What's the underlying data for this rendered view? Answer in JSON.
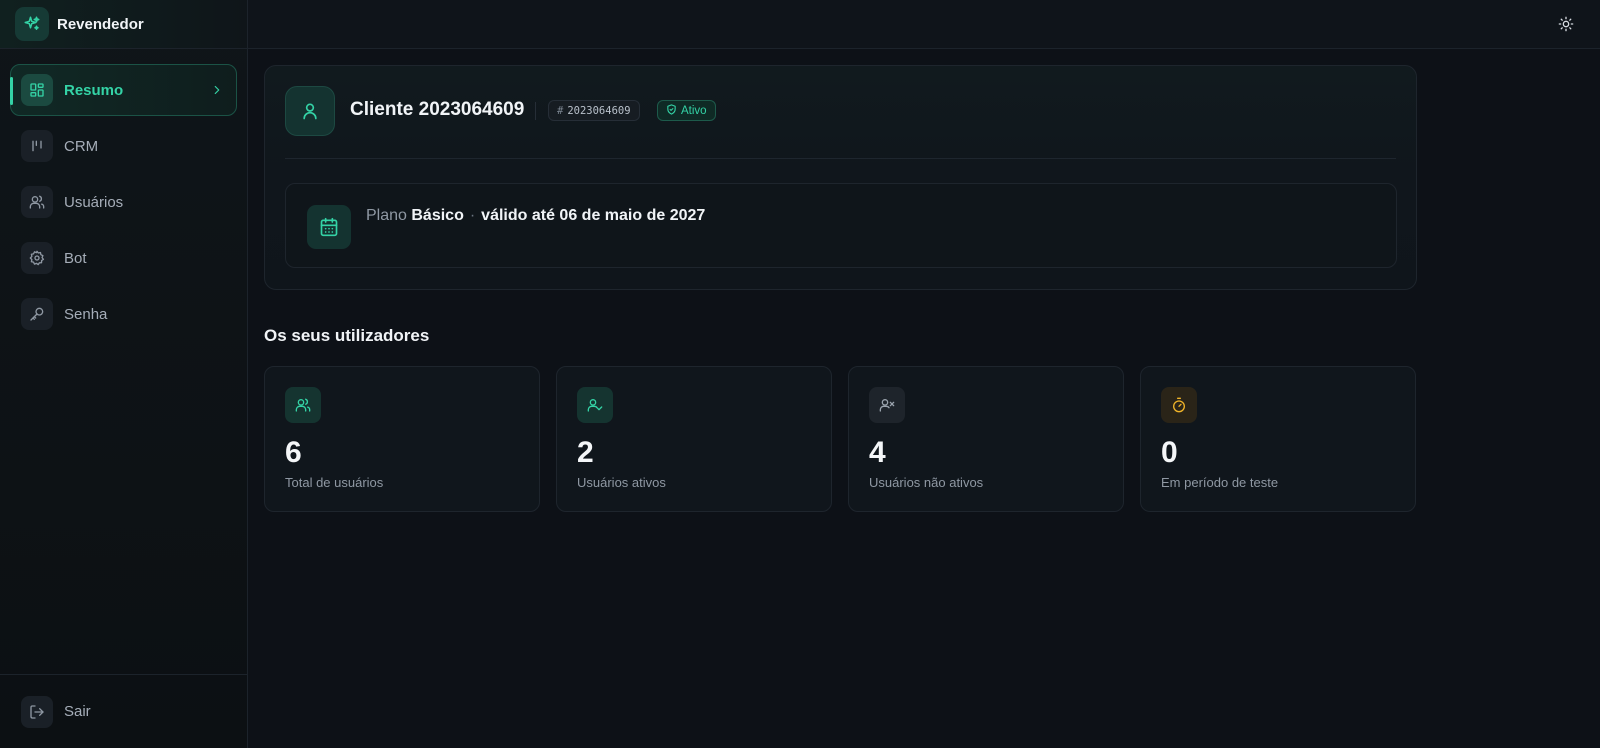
{
  "brand": {
    "name": "Revendedor",
    "icon": "sparkles-icon"
  },
  "nav": {
    "items": [
      {
        "label": "Resumo",
        "icon": "dashboard-grid-icon",
        "active": true
      },
      {
        "label": "CRM",
        "icon": "kanban-icon",
        "active": false
      },
      {
        "label": "Usuários",
        "icon": "users-icon",
        "active": false
      },
      {
        "label": "Bot",
        "icon": "gear-icon",
        "active": false
      },
      {
        "label": "Senha",
        "icon": "key-icon",
        "active": false
      }
    ],
    "logout_label": "Sair"
  },
  "topbar": {
    "theme_toggle_icon": "sun-icon"
  },
  "client": {
    "title": "Cliente 2023064609",
    "id_hash": "#",
    "id": "2023064609",
    "status": "Ativo",
    "plan_prefix": "Plano",
    "plan_name": "Básico",
    "plan_separator": "·",
    "plan_validity": "válido até 06 de maio de 2027"
  },
  "users_section": {
    "title": "Os seus utilizadores",
    "stats": [
      {
        "value": "6",
        "label": "Total de usuários",
        "icon": "users-icon",
        "color": "#34d3a6"
      },
      {
        "value": "2",
        "label": "Usuários ativos",
        "icon": "user-check-icon",
        "color": "#34d3a6"
      },
      {
        "value": "4",
        "label": "Usuários não ativos",
        "icon": "user-x-icon",
        "color": "#9aa3ad"
      },
      {
        "value": "0",
        "label": "Em período de teste",
        "icon": "timer-icon",
        "color": "#f0b429"
      }
    ]
  },
  "colors": {
    "accent": "#34d3a6",
    "background": "#0d1117",
    "warning": "#f0b429"
  }
}
